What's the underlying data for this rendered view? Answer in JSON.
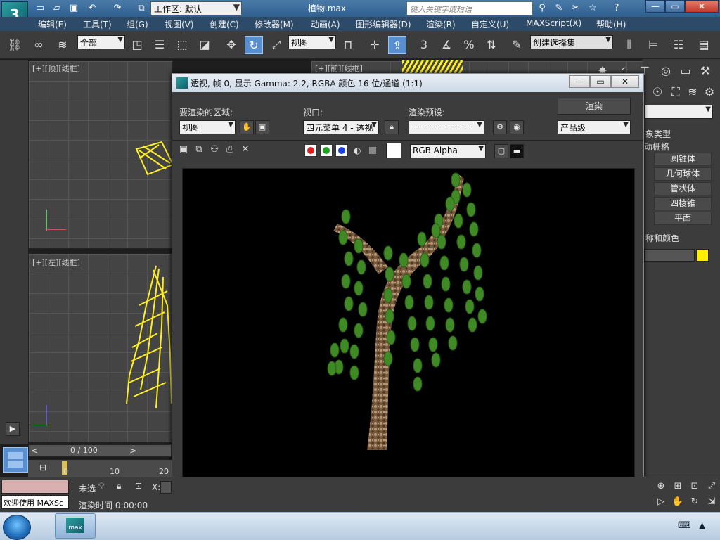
{
  "app": {
    "workspace_label": "工作区: 默认",
    "file_name": "植物.max",
    "search_placeholder": "键入关键字或短语",
    "logo_text": "3",
    "quick_access_icons": [
      "new-file-icon",
      "open-folder-icon",
      "save-icon",
      "undo-icon",
      "redo-icon",
      "project-icon"
    ],
    "window_controls": [
      "—",
      "▭",
      "✕"
    ]
  },
  "menubar": {
    "items": [
      "编辑(E)",
      "工具(T)",
      "组(G)",
      "视图(V)",
      "创建(C)",
      "修改器(M)",
      "动画(A)",
      "图形编辑器(D)",
      "渲染(R)",
      "自定义(U)",
      "MAXScript(X)",
      "帮助(H)"
    ]
  },
  "toolbar": {
    "selection_filter": "全部",
    "reference_coord": "视图",
    "named_selection": "创建选择集",
    "snap_label": "3"
  },
  "viewports": {
    "top_left_label": "[+][顶][线框]",
    "top_right_label": "[+][前][线框]",
    "bottom_left_label": "[+][左][线框]"
  },
  "create_panel": {
    "section_title": "象类型",
    "autogrid": "动栅格",
    "buttons": [
      "圆锥体",
      "几何球体",
      "管状体",
      "四棱锥",
      "平面"
    ],
    "name_color_title": "称和颜色",
    "object_color": "#ffee00"
  },
  "render_frame": {
    "title": "透视, 帧 0, 显示 Gamma: 2.2, RGBA 颜色 16 位/通道 (1:1)",
    "area_label": "要渲染的区域:",
    "area_value": "视图",
    "viewport_label": "视口:",
    "viewport_value": "四元菜单 4 - 透视",
    "preset_label": "渲染预设:",
    "preset_value": "--------------------",
    "render_button": "渲染",
    "quality_value": "产品级",
    "channel_value": "RGB Alpha",
    "channel_colors": [
      "#e02020",
      "#20a020",
      "#2040e0"
    ]
  },
  "timeline": {
    "frame_display": "0 / 100",
    "ruler_ticks": [
      "0",
      "10",
      "20"
    ]
  },
  "status": {
    "maxscript_text": "欢迎使用 MAXSc",
    "selection_text": "未选",
    "render_time": "渲染时间 0:00:00",
    "x_label": "X:"
  },
  "taskbar": {
    "app_label": "max"
  }
}
